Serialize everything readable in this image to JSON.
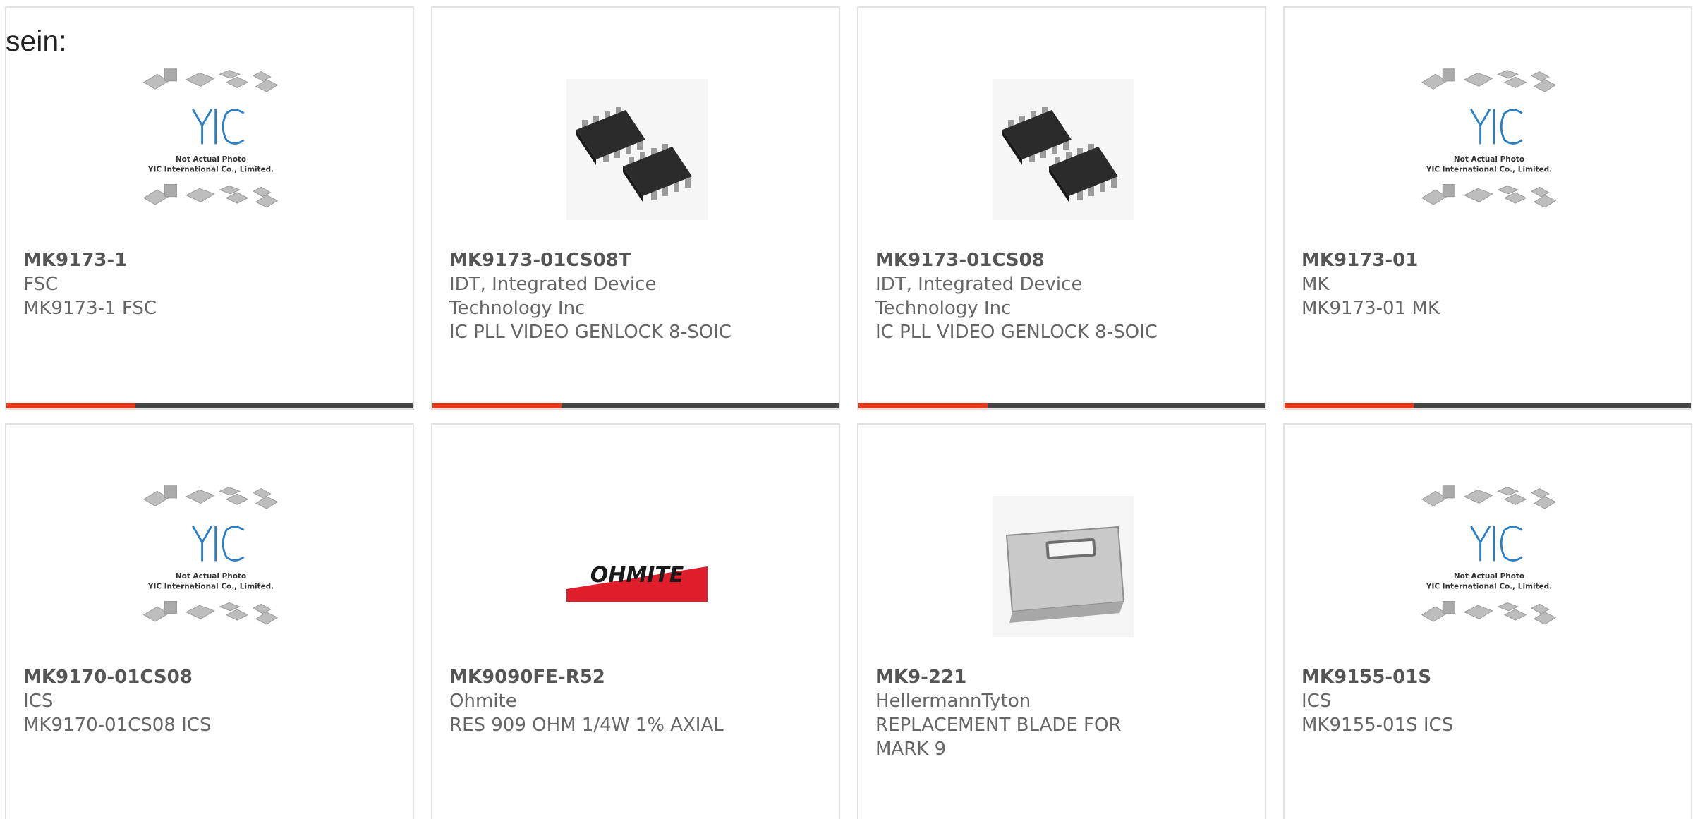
{
  "fragment": "sein:",
  "accent_color": "#e8381b",
  "bar_color": "#444444",
  "placeholder_image": {
    "lines": [
      "Not Actual Photo",
      "YIC International Co., Limited."
    ],
    "logo_text": "YIC",
    "logo_color": "#2b7fc4"
  },
  "ohmite_logo_text": "OHMITE",
  "products": [
    {
      "part": "MK9173-1",
      "maker": "FSC",
      "desc": "MK9173-1 FSC",
      "image": "placeholder"
    },
    {
      "part": "MK9173-01CS08T",
      "maker": "IDT, Integrated Device Technology Inc",
      "desc": "IC PLL VIDEO GENLOCK 8-SOIC",
      "image": "soic"
    },
    {
      "part": "MK9173-01CS08",
      "maker": "IDT, Integrated Device Technology Inc",
      "desc": "IC PLL VIDEO GENLOCK 8-SOIC",
      "image": "soic"
    },
    {
      "part": "MK9173-01",
      "maker": "MK",
      "desc": "MK9173-01 MK",
      "image": "placeholder"
    },
    {
      "part": "MK9170-01CS08",
      "maker": "ICS",
      "desc": "MK9170-01CS08 ICS",
      "image": "placeholder"
    },
    {
      "part": "MK9090FE-R52",
      "maker": "Ohmite",
      "desc": "RES 909 OHM 1/4W 1% AXIAL",
      "image": "ohmite-logo"
    },
    {
      "part": "MK9-221",
      "maker": "HellermannTyton",
      "desc": "REPLACEMENT BLADE FOR MARK 9",
      "image": "blade"
    },
    {
      "part": "MK9155-01S",
      "maker": "ICS",
      "desc": "MK9155-01S ICS",
      "image": "placeholder"
    }
  ]
}
